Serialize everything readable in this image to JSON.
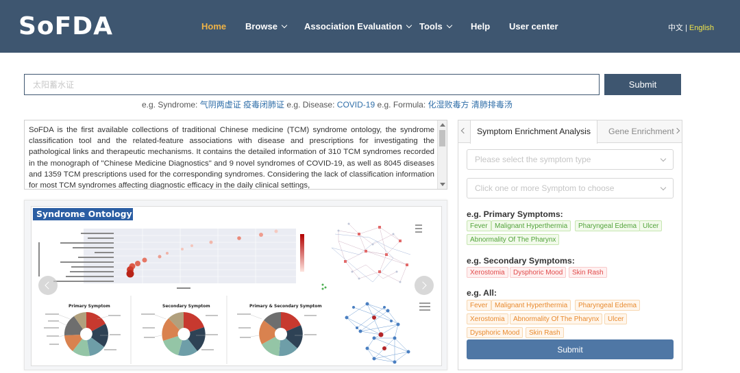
{
  "header": {
    "logo": "SoFDA",
    "nav": [
      {
        "label": "Home",
        "active": true,
        "dropdown": false
      },
      {
        "label": "Browse",
        "active": false,
        "dropdown": true
      },
      {
        "label": "Association Evaluation",
        "active": false,
        "dropdown": true
      },
      {
        "label": "Tools",
        "active": false,
        "dropdown": true
      },
      {
        "label": "Help",
        "active": false,
        "dropdown": false
      },
      {
        "label": "User center",
        "active": false,
        "dropdown": false
      }
    ],
    "lang_zh": "中文",
    "lang_sep": " | ",
    "lang_en": "English"
  },
  "search": {
    "placeholder": "太阳蓄水证",
    "submit_label": "Submit",
    "examples": {
      "syndrome_prefix": "e.g. Syndrome: ",
      "syndrome_values": "气阴两虚证 疫毒闭肺证",
      "disease_prefix": " e.g. Disease: ",
      "disease_value": "COVID-19",
      "formula_prefix": " e.g. Formula: ",
      "formula_values": "化湿败毒方 清肺排毒汤"
    }
  },
  "intro": {
    "text": "SoFDA is the first available collections of traditional Chinese medicine (TCM) syndrome ontology, the syndrome classification tool and the related-feature associations with disease and prescriptions for investigating the pathological links and therapeutic mechanisms. It contains the detailed information of 310 TCM syndromes recorded in the monograph of \"Chinese Medicine Diagnostics\" and 9 novel syndromes of COVID-19, as well as 8045 diseases and 1359 TCM prescriptions used for the corresponding syndromes. Considering the lack of classification information for most TCM syndromes affecting diagnostic efficacy in the daily clinical settings,"
  },
  "carousel": {
    "slide_title": "Syndrome Ontology",
    "sub_titles": [
      "Primary Symptom",
      "Secondary Symptom",
      "Primary & Secondary Symptom"
    ]
  },
  "panel": {
    "tabs": [
      "Symptom Enrichment Analysis",
      "Gene Enrichment"
    ],
    "select_type_placeholder": "Please select the symptom type",
    "select_symptom_placeholder": "Click one or more Symptom to choose",
    "primary_title": "e.g. Primary Symptoms:",
    "primary_tags": [
      "Fever",
      "Malignant Hyperthermia",
      "Pharyngeal Edema",
      "Ulcer",
      "Abnormality Of The Pharynx"
    ],
    "secondary_title": "e.g. Secondary Symptoms:",
    "secondary_tags": [
      "Xerostomia",
      "Dysphoric Mood",
      "Skin Rash"
    ],
    "all_title": "e.g. All:",
    "all_tags": [
      "Fever",
      "Malignant Hyperthermia",
      "Pharyngeal Edema",
      "Xerostomia",
      "Abnormality Of The Pharynx",
      "Ulcer",
      "Dysphoric Mood",
      "Skin Rash"
    ],
    "submit_label": "Submit"
  },
  "colors": {
    "header_bg": "#3e5670",
    "nav_active": "#f0b346",
    "primary_tag": "#52a33a",
    "secondary_tag": "#e04a4a",
    "all_tag": "#e88a2e",
    "panel_submit": "#4f77a5"
  }
}
